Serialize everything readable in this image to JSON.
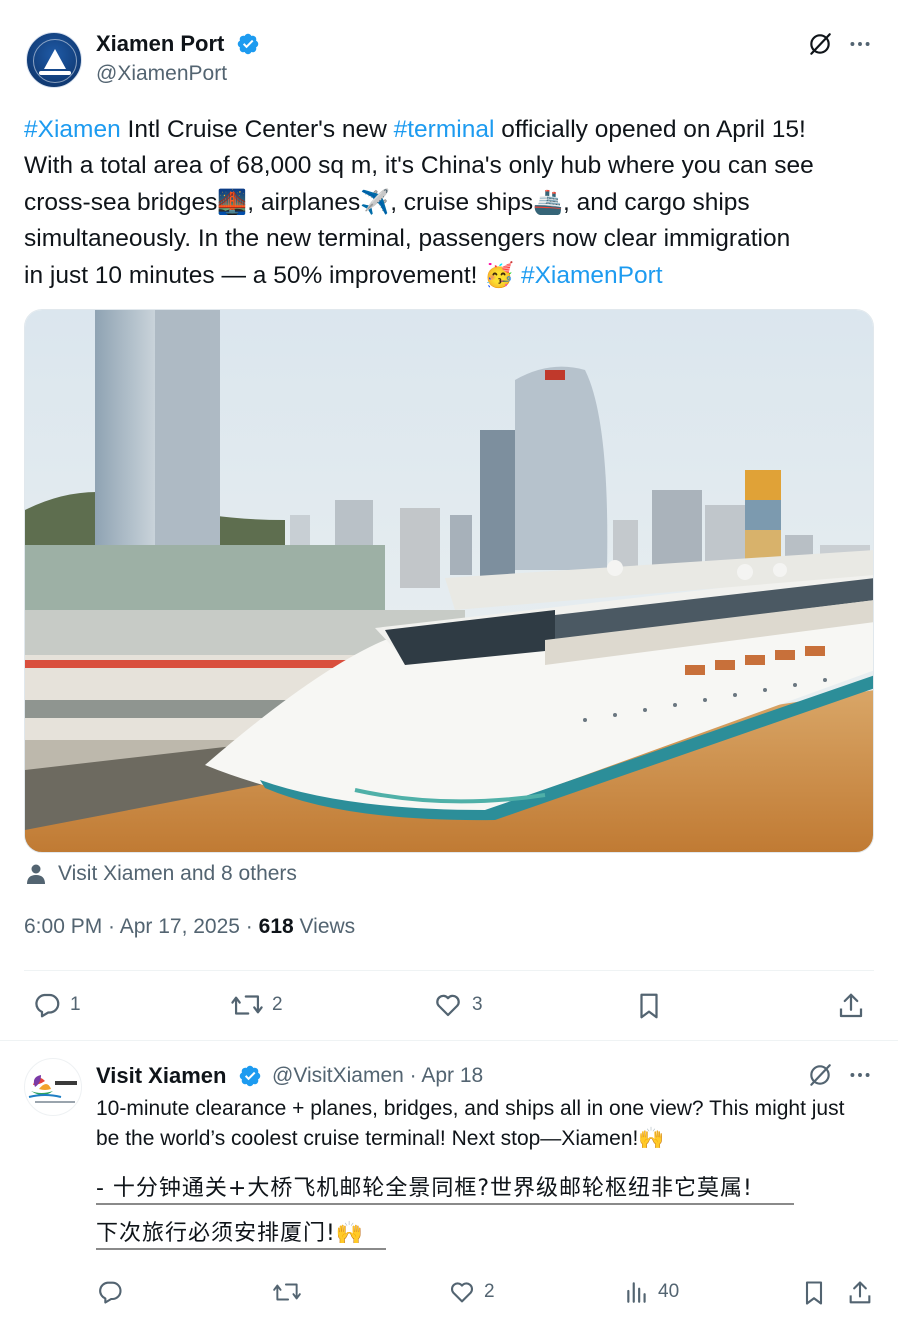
{
  "post": {
    "author_name": "Xiamen Port",
    "author_handle": "@XiamenPort",
    "text": {
      "t1_tag": "#Xiamen",
      "t1_rest": " Intl Cruise Center's new ",
      "t2_tag": "#terminal",
      "t2_rest": " officially opened on April 15!",
      "line2": "With a total area of 68,000 sq m, it's China's only hub where you can see",
      "line3_a": "cross-sea bridges",
      "emoji_bridge": "🌉",
      "line3_b": ", airplanes",
      "emoji_plane": "✈️",
      "line3_c": ", cruise ships",
      "emoji_ship": "🚢",
      "line3_d": ", and cargo ships",
      "line4": "simultaneously. In the new terminal, passengers now clear immigration",
      "line5": "in just 10 minutes — a 50% improvement! ",
      "emoji_party": "🥳",
      "line5_tag": " #XiamenPort"
    },
    "tagged_people": "Visit Xiamen and 8 others",
    "time": "6:00 PM · Apr 17, 2025 · ",
    "views_count": "618",
    "views_label": " Views",
    "stats": {
      "replies": "1",
      "reposts": "2",
      "likes": "3"
    }
  },
  "reply": {
    "author_name": "Visit Xiamen",
    "author_handle": "@VisitXiamen · Apr 18",
    "text": "10-minute clearance + planes, bridges, and ships all in one view? This might just be the world’s coolest cruise terminal! Next stop—Xiamen!🙌",
    "cn_line1": "- 十分钟通关+大桥飞机邮轮全景同框?世界级邮轮枢纽非它莫属!",
    "cn_line2": "下次旅行必须安排厦门!🙌",
    "stats": {
      "likes": "2",
      "views": "40"
    }
  },
  "icons": {
    "verified": "verified-badge-icon",
    "grok": "grok-icon",
    "more": "more-icon",
    "reply": "reply-icon",
    "repost": "repost-icon",
    "like": "like-icon",
    "bookmark": "bookmark-icon",
    "share": "share-icon",
    "views": "views-icon",
    "person": "person-icon"
  },
  "colors": {
    "accent": "#1d9bf0",
    "secondary_text": "#536471",
    "primary_text": "#0f1419"
  }
}
